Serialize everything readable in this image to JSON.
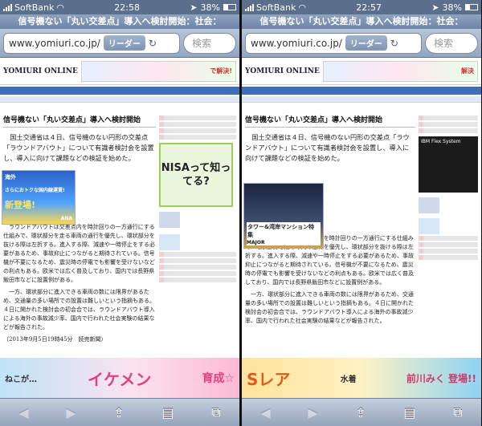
{
  "left": {
    "carrier": "SoftBank",
    "time": "22:58",
    "battery": "38%",
    "page_title": "信号機ない「丸い交差点」導入へ検討開始：社会：",
    "url": "www.yomiuri.co.jp/",
    "reader_label": "リーダー",
    "search_placeholder": "検索",
    "logo": "YOMIURI ONLINE",
    "ad_top_text": "で解決!",
    "headline": "信号機ない「丸い交差点」導入へ検討開始",
    "para1": "国土交通省は４日、信号機のない円形の交差点「ラウンドアバウト」について有識者検討会を設置し、導入に向けて課題などの検証を始めた。",
    "para2": "ラウンドアバウトは交差点内を時計回りの一方通行にする仕組みで、環状部分を走る車両の通行を優先し、環状部分を抜ける際は左折する。進入する際、減速や一時停止をする必要があるため、事故抑止につながると期待されている。信号機が不要になるため、震災時の停電でも影響を受けないなどの利点もある。欧米では広く普及しており、国内では長野県飯田市などに設置例がある。",
    "para3": "一方、環状部分に進入できる車両の数には限界があるため、交通量の多い場所での設置は難しいという指摘もある。４日に開かれた検討会の初会合では、ラウンドアバウト導入による海外の事故減少率、国内で行われた社会実験の結果などが報告された。",
    "dateline": "（2013年9月5日19時45分　読売新聞）",
    "nisa_ad": "NISAって知ってる?",
    "inline_ad_top": "海外",
    "inline_ad_main": "さらにおトクな国内線運賃!",
    "inline_ad_new": "新登場!",
    "inline_ad_brand": "ANA",
    "bottom_ad_left": "ねこが…",
    "bottom_ad_mid": "イケメン",
    "bottom_ad_right": "育成☆"
  },
  "right": {
    "carrier": "SoftBank",
    "time": "22:57",
    "battery": "38%",
    "page_title": "信号機ない「丸い交差点」導入へ検討開始：社会：",
    "url": "www.yomiuri.co.jp/",
    "reader_label": "リーダー",
    "search_placeholder": "検索",
    "logo": "YOMIURI ONLINE",
    "ad_top_text": "解決",
    "headline": "信号機ない「丸い交差点」導入へ検討開始",
    "para1": "国土交通省は４日、信号機のない円形の交差点「ラウンドアバウト」について有識者検討会を設置し、導入に向けて課題などの検証を始めた。",
    "para2": "ラウンドアバウトは交差点内を時計回りの一方通行にする仕組みで、環状部分を走る車両の通行を優先し、環状部分を抜ける際は左折する。進入する際、減速や一時停止をする必要があるため、事故抑止につながると期待されている。信号機が不要になるため、震災時の停電でも影響を受けないなどの利点もある。欧米では広く普及しており、国内では長野県飯田市などに設置例がある。",
    "para3": "一方、環状部分に進入できる車両の数には限界があるため、交通量の多い場所での設置は難しいという指摘もある。４日に開かれた検討会の初会合では、ラウンドアバウト導入による海外の事故減少率、国内で行われた社会実験の結果などが報告された。",
    "side_ad": "IBM Flex System",
    "inline_ad_text": "タワー&湾岸マンション特集",
    "inline_ad_brand": "MAJOR",
    "bottom_ad_left": "Sレア",
    "bottom_ad_mid": "水着",
    "bottom_ad_right": "前川みく 登場!!"
  },
  "colors": {
    "accent": "#3d6fb6",
    "status": "#5b6f8c",
    "toolbar": "#95a4bb"
  }
}
